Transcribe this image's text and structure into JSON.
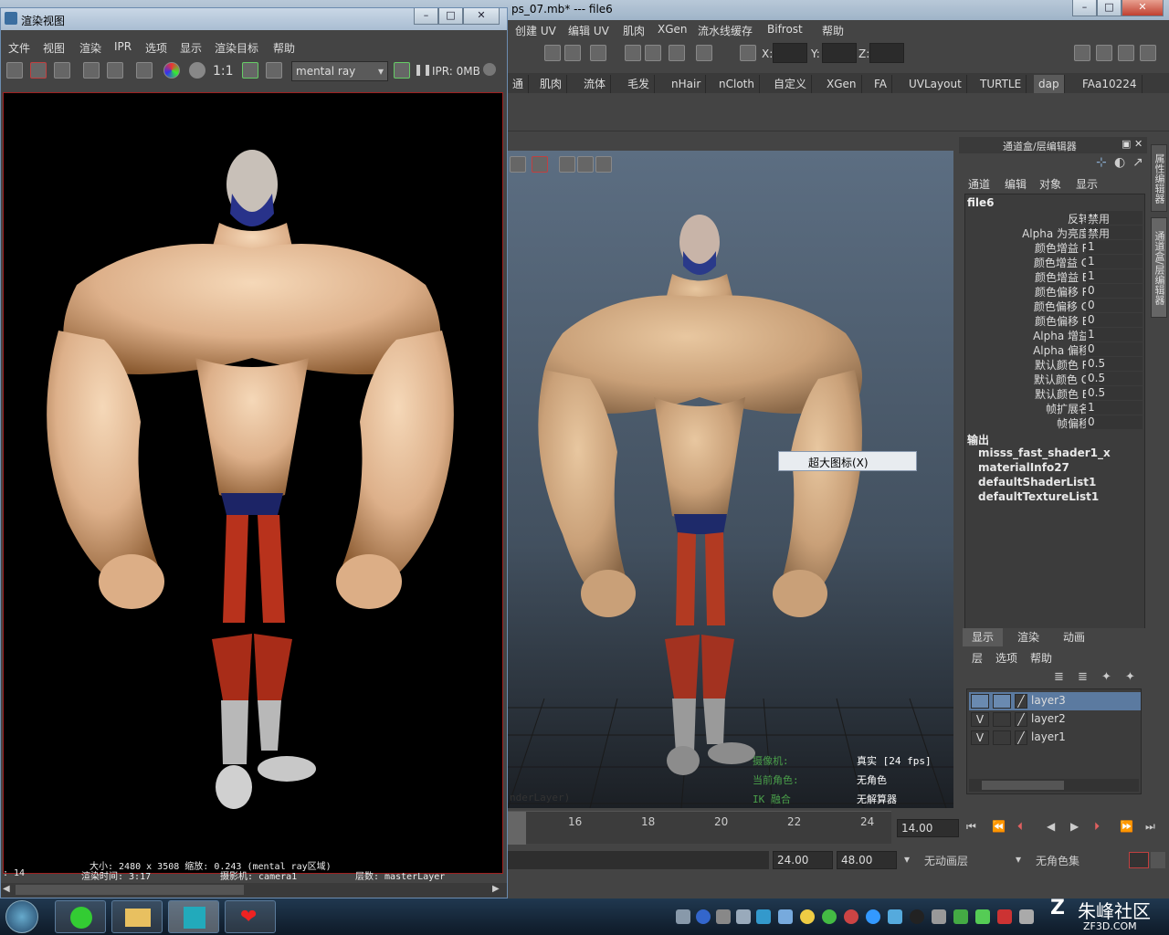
{
  "maya": {
    "title": "ps_07.mb*   ---   file6",
    "menu": [
      "创建 UV",
      "编辑 UV",
      "肌肉",
      "XGen",
      "流水线缓存",
      "Bifrost",
      "帮助"
    ],
    "coords": {
      "x": "X:",
      "y": "Y:",
      "z": "Z:"
    },
    "shelf_tabs": [
      "通",
      "肌肉",
      "流体",
      "毛发",
      "nHair",
      "nCloth",
      "自定义",
      "XGen",
      "FA",
      "UVLayout",
      "TURTLE",
      "dap",
      "FAa10224"
    ],
    "active_shelf_tab": "dap"
  },
  "viewport": {
    "context_menu_item": "超大图标(X)",
    "hud_left": [
      "摄像机:",
      "当前角色:",
      "IK 融合"
    ],
    "hud_right": [
      "真实 [24 fps]",
      "无角色",
      "无解算器"
    ],
    "layer_label": "nderLayer)"
  },
  "channel_box": {
    "header": "通道盒/层编辑器",
    "menu": [
      "通道",
      "编辑",
      "对象",
      "显示"
    ],
    "node": "file6",
    "attributes": [
      {
        "label": "反转",
        "value": "禁用"
      },
      {
        "label": "Alpha 为亮度",
        "value": "禁用"
      },
      {
        "label": "颜色增益 R",
        "value": "1"
      },
      {
        "label": "颜色增益 G",
        "value": "1"
      },
      {
        "label": "颜色增益 B",
        "value": "1"
      },
      {
        "label": "颜色偏移 R",
        "value": "0"
      },
      {
        "label": "颜色偏移 G",
        "value": "0"
      },
      {
        "label": "颜色偏移 B",
        "value": "0"
      },
      {
        "label": "Alpha 增益",
        "value": "1"
      },
      {
        "label": "Alpha 偏移",
        "value": "0"
      },
      {
        "label": "默认颜色 R",
        "value": "0.5"
      },
      {
        "label": "默认颜色 G",
        "value": "0.5"
      },
      {
        "label": "默认颜色 B",
        "value": "0.5"
      },
      {
        "label": "帧扩展名",
        "value": "1"
      },
      {
        "label": "帧偏移",
        "value": "0"
      }
    ],
    "outputs_label": "输出",
    "outputs": [
      "misss_fast_shader1_x",
      "materialInfo27",
      "defaultShaderList1",
      "defaultTextureList1"
    ]
  },
  "side_tabs": [
    "属性编辑器",
    "通道盒/层编辑器"
  ],
  "layer_editor": {
    "tabs": [
      "显示",
      "渲染",
      "动画"
    ],
    "active_tab": "显示",
    "menu": [
      "层",
      "选项",
      "帮助"
    ],
    "layers": [
      {
        "name": "layer3",
        "visible": "",
        "selected": true
      },
      {
        "name": "layer2",
        "visible": "V",
        "selected": false
      },
      {
        "name": "layer1",
        "visible": "V",
        "selected": false
      }
    ]
  },
  "time_slider": {
    "ticks": [
      "16",
      "18",
      "20",
      "22",
      "24"
    ],
    "current_frame": "14.00",
    "range_end": "24.00",
    "anim_end": "48.00",
    "anim_layer": "无动画层",
    "char_set": "无角色集"
  },
  "render_view": {
    "title": "渲染视图",
    "menu": [
      "文件",
      "视图",
      "渲染",
      "IPR",
      "选项",
      "显示",
      "渲染目标",
      "帮助"
    ],
    "ratio": "1:1",
    "renderer": "mental ray",
    "ipr_status": "IPR: 0MB",
    "info_line1": "大小: 2480 x 3508 缩放: 0.243        (mental ray区域)",
    "info_line2_a": ": 14",
    "info_line2_b": "渲染时间:  3:17",
    "info_line2_c": "摄影机: camera1",
    "info_line2_d": "层数: masterLayer"
  },
  "watermark": {
    "text": "朱峰社区",
    "sub": "ZF3D.COM"
  },
  "colors": {
    "accent": "#5b7aa0",
    "render_border": "#a02020",
    "bg": "#444444"
  }
}
